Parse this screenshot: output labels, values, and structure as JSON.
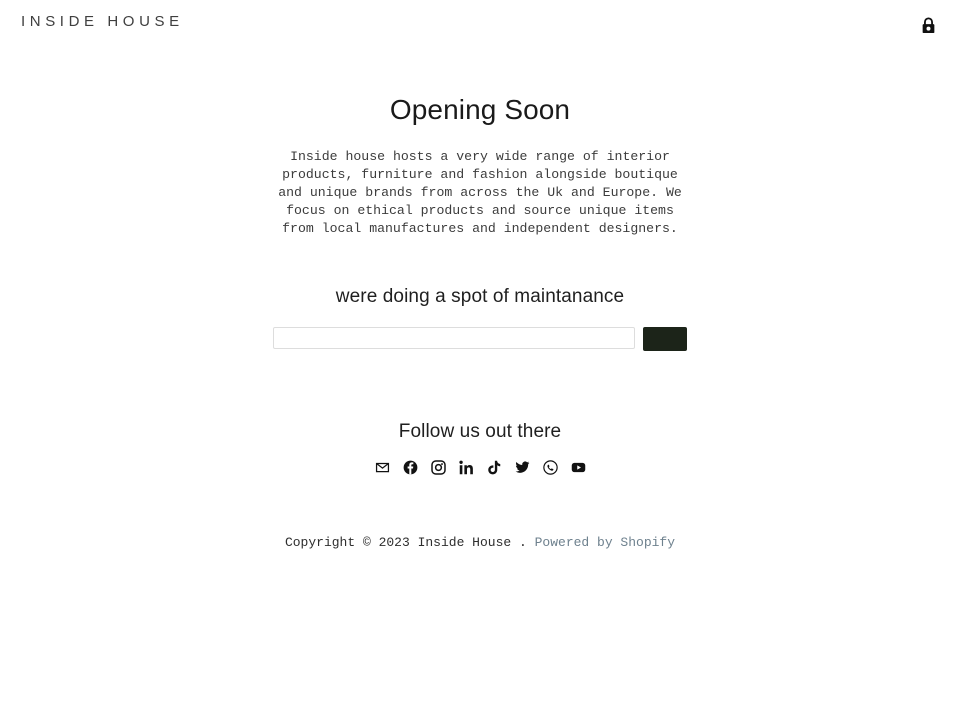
{
  "header": {
    "logo_text": "INSIDE HOUSE",
    "lock_icon": "lock-closed-icon",
    "lock_label": "Password protected store"
  },
  "main": {
    "heading": "Opening Soon",
    "intro": "Inside house hosts a very wide range of interior products, furniture and fashion alongside boutique and unique brands from across the Uk and Europe. We focus on ethical products and source unique items from local manufactures and independent designers.",
    "maintenance_heading": "were doing a spot of maintanance",
    "signup": {
      "input_value": "",
      "input_placeholder": "",
      "submit_label": "",
      "submit_color": "#1c2419"
    },
    "social_heading": "Follow us out there",
    "social_links": [
      {
        "name": "email",
        "icon": "email-icon",
        "label": "Email"
      },
      {
        "name": "facebook",
        "icon": "facebook-icon",
        "label": "Facebook"
      },
      {
        "name": "instagram",
        "icon": "instagram-icon",
        "label": "Instagram"
      },
      {
        "name": "linkedin",
        "icon": "linkedin-icon",
        "label": "LinkedIn"
      },
      {
        "name": "tiktok",
        "icon": "tiktok-icon",
        "label": "TikTok"
      },
      {
        "name": "twitter",
        "icon": "twitter-icon",
        "label": "Twitter"
      },
      {
        "name": "whatsapp",
        "icon": "whatsapp-icon",
        "label": "WhatsApp"
      },
      {
        "name": "youtube",
        "icon": "youtube-icon",
        "label": "YouTube"
      }
    ]
  },
  "footer": {
    "copyright": "Copyright © 2023 Inside House .",
    "powered_by": "Powered by Shopify",
    "link_color": "#6e818e"
  }
}
